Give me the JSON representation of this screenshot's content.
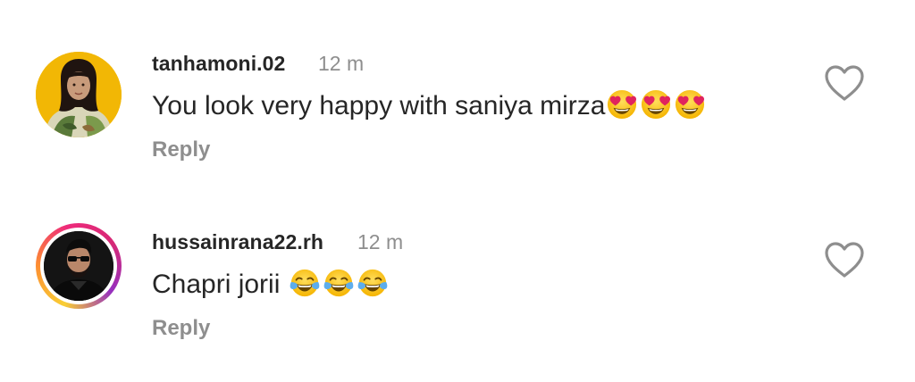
{
  "comments": [
    {
      "username": "tanhamoni.02",
      "timestamp": "12 m",
      "text": "You look very happy with saniya mirza",
      "emojis": [
        "heart-eyes-emoji",
        "heart-eyes-emoji",
        "heart-eyes-emoji"
      ],
      "reply_label": "Reply",
      "avatar_ring": "none"
    },
    {
      "username": "hussainrana22.rh",
      "timestamp": "12 m",
      "text": "Chapri jorii",
      "emojis": [
        "tears-of-joy-emoji",
        "tears-of-joy-emoji",
        "tears-of-joy-emoji"
      ],
      "reply_label": "Reply",
      "avatar_ring": "story-gradient"
    }
  ],
  "colors": {
    "text_primary": "#262626",
    "text_secondary": "#8e8e8e",
    "background": "#ffffff",
    "like_icon": "#8e8e8e"
  },
  "icons": {
    "like": "heart-outline-icon"
  }
}
